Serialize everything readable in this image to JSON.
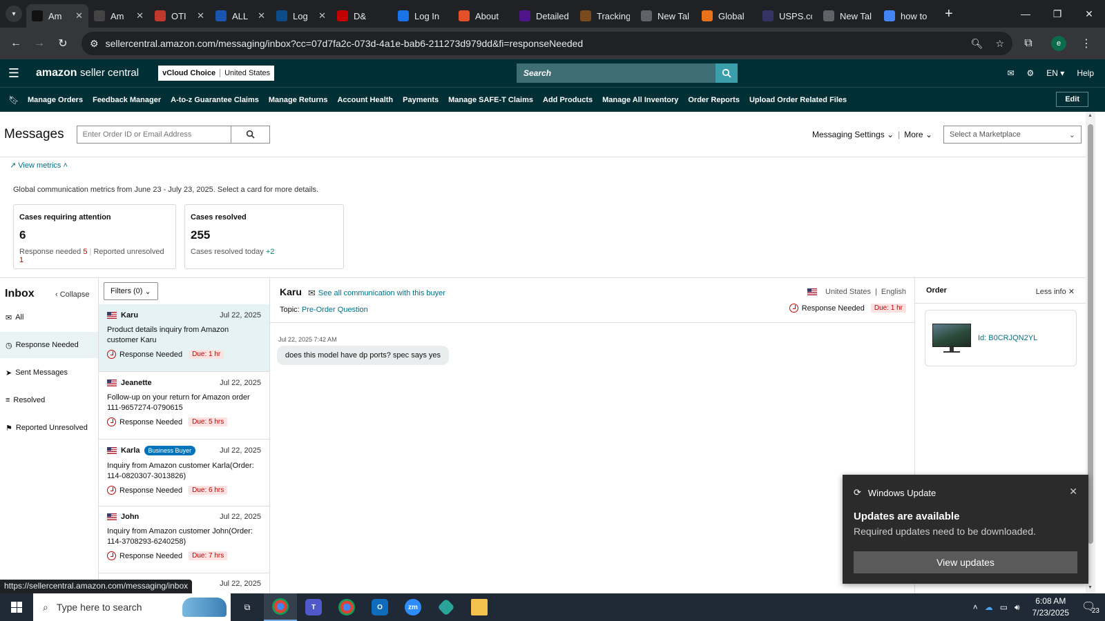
{
  "browser": {
    "tabs": [
      {
        "title": "Am",
        "favicon": "amazon",
        "color": "#111"
      },
      {
        "title": "Am",
        "favicon": "amazon",
        "color": "#444"
      },
      {
        "title": "OTI",
        "favicon": "oti",
        "color": "#c0392b"
      },
      {
        "title": "ALL",
        "favicon": "17track",
        "color": "#1a56b0"
      },
      {
        "title": "Log",
        "favicon": "ec",
        "color": "#0d4c8c"
      },
      {
        "title": "D&",
        "favicon": "dh",
        "color": "#c40000"
      },
      {
        "title": "Log In",
        "favicon": "g",
        "color": "#1a73e8"
      },
      {
        "title": "About",
        "favicon": "stack",
        "color": "#e34f26"
      },
      {
        "title": "Detailed",
        "favicon": "fedex",
        "color": "#4d148c"
      },
      {
        "title": "Tracking",
        "favicon": "ups",
        "color": "#7a4a1a"
      },
      {
        "title": "New Tal",
        "favicon": "globe",
        "color": "#5f6368"
      },
      {
        "title": "Global",
        "favicon": "fire",
        "color": "#e8711a"
      },
      {
        "title": "USPS.co",
        "favicon": "usps",
        "color": "#333366"
      },
      {
        "title": "New Tal",
        "favicon": "globe",
        "color": "#5f6368"
      },
      {
        "title": "how to",
        "favicon": "google",
        "color": "#4285f4"
      }
    ],
    "url": "sellercentral.amazon.com/messaging/inbox?cc=07d7fa2c-073d-4a1e-bab6-211273d979dd&fi=responseNeeded",
    "status_url": "https://sellercentral.amazon.com/messaging/inbox"
  },
  "header": {
    "logo_brand": "amazon",
    "logo_product": "seller central",
    "store_name": "vCloud Choice",
    "store_region": "United States",
    "search_placeholder": "Search",
    "language": "EN",
    "help": "Help"
  },
  "nav_links": [
    "Manage Orders",
    "Feedback Manager",
    "A-to-z Guarantee Claims",
    "Manage Returns",
    "Account Health",
    "Payments",
    "Manage SAFE-T Claims",
    "Add Products",
    "Manage All Inventory",
    "Order Reports",
    "Upload Order Related Files"
  ],
  "nav_edit": "Edit",
  "messages": {
    "title": "Messages",
    "search_placeholder": "Enter Order ID or Email Address",
    "settings": "Messaging Settings",
    "more": "More",
    "marketplace_placeholder": "Select a Marketplace"
  },
  "metrics": {
    "toggle": "View metrics",
    "description": "Global communication metrics from June 23 - July 23, 2025. Select a card for more details.",
    "attention": {
      "title": "Cases requiring attention",
      "value": "6",
      "resp_label": "Response needed",
      "resp_value": "5",
      "unres_label": "Reported unresolved",
      "unres_value": "1"
    },
    "resolved": {
      "title": "Cases resolved",
      "value": "255",
      "today_label": "Cases resolved today",
      "today_value": "+2"
    }
  },
  "inbox": {
    "title": "Inbox",
    "collapse": "Collapse",
    "folders": [
      "All",
      "Response Needed",
      "Sent Messages",
      "Resolved",
      "Reported Unresolved"
    ],
    "filters": "Filters (0)",
    "conversations": [
      {
        "name": "Karu",
        "date": "Jul 22, 2025",
        "subject": "Product details inquiry from Amazon customer Karu",
        "status": "Response Needed",
        "due": "Due: 1 hr",
        "badge": ""
      },
      {
        "name": "Jeanette",
        "date": "Jul 22, 2025",
        "subject": "Follow-up on your return for Amazon order 111-9657274-0790615",
        "status": "Response Needed",
        "due": "Due: 5 hrs",
        "badge": ""
      },
      {
        "name": "Karla",
        "date": "Jul 22, 2025",
        "subject": "Inquiry from Amazon customer Karla(Order: 114-0820307-3013826)",
        "status": "Response Needed",
        "due": "Due: 6 hrs",
        "badge": "Business Buyer"
      },
      {
        "name": "John",
        "date": "Jul 22, 2025",
        "subject": "Inquiry from Amazon customer John(Order: 114-3708293-6240258)",
        "status": "Response Needed",
        "due": "Due: 7 hrs",
        "badge": ""
      },
      {
        "name": "",
        "date": "Jul 22, 2025"
      }
    ]
  },
  "detail": {
    "buyer": "Karu",
    "see_all": "See all communication with this buyer",
    "topic_label": "Topic:",
    "topic": "Pre-Order Question",
    "country": "United States",
    "language": "English",
    "status": "Response Needed",
    "due": "Due: 1 hr",
    "message_time": "Jul 22, 2025 7:42 AM",
    "message_text": "does this model  have  dp ports? spec says yes"
  },
  "order_panel": {
    "title": "Order",
    "less_info": "Less info",
    "product_id": "Id: B0CRJQN2YL"
  },
  "toast": {
    "app": "Windows Update",
    "title": "Updates are available",
    "message": "Required updates need to be downloaded.",
    "button": "View updates"
  },
  "taskbar": {
    "search_placeholder": "Type here to search",
    "time": "6:08 AM",
    "date": "7/23/2025",
    "notification_count": "23"
  }
}
